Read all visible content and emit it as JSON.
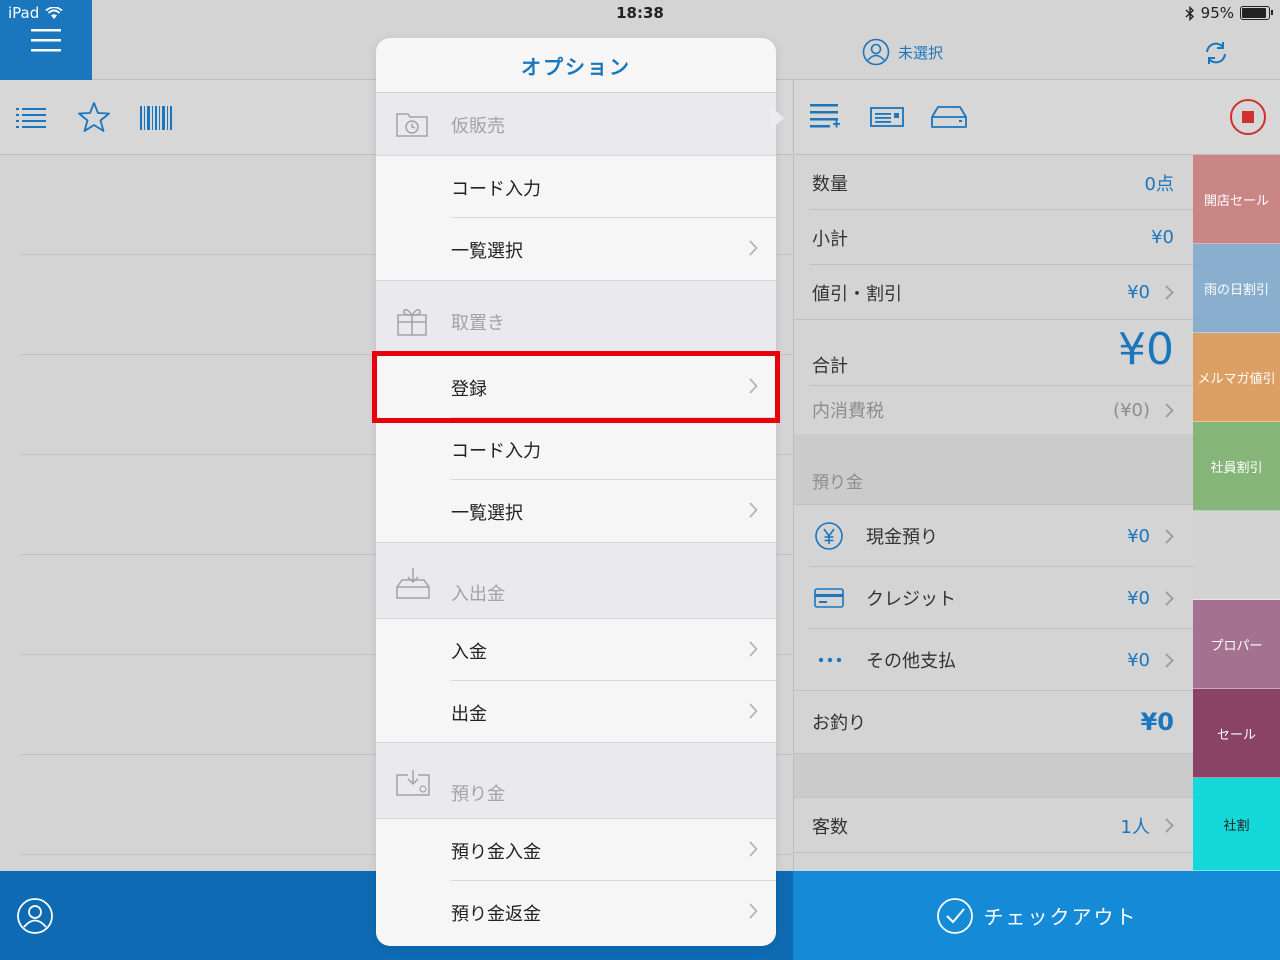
{
  "status_bar": {
    "device": "iPad",
    "time": "18:38",
    "battery": "95%",
    "battery_level": 0.95
  },
  "header": {
    "customer_label": "未選択"
  },
  "summary": {
    "quantity_label": "数量",
    "quantity_value": "0点",
    "subtotal_label": "小計",
    "subtotal_value": "¥0",
    "discount_label": "値引・割引",
    "discount_value": "¥0",
    "total_label": "合計",
    "total_value": "¥0",
    "tax_label": "内消費税",
    "tax_value": "(¥0)",
    "deposit_section": "預り金",
    "cash_label": "現金預り",
    "cash_value": "¥0",
    "credit_label": "クレジット",
    "credit_value": "¥0",
    "other_label": "その他支払",
    "other_value": "¥0",
    "change_label": "お釣り",
    "change_value": "¥0",
    "guests_label": "客数",
    "guests_value": "1人"
  },
  "discount_buttons": [
    {
      "label": "開店セール",
      "color": "#c98684"
    },
    {
      "label": "雨の日割引",
      "color": "#8aaecd"
    },
    {
      "label": "メルマガ値引",
      "color": "#dda064"
    },
    {
      "label": "社員割引",
      "color": "#86b57a"
    },
    {
      "label": "",
      "color": "#d3d3d3"
    },
    {
      "label": "プロパー",
      "color": "#a57190"
    },
    {
      "label": "セール",
      "color": "#8a4366"
    },
    {
      "label": "社割",
      "color": "#14d8da"
    }
  ],
  "checkout": {
    "label": "チェックアウト"
  },
  "popover": {
    "title": "オプション",
    "sections": [
      {
        "title": "仮販売",
        "icon": "clock-folder-icon",
        "items": [
          "コード入力",
          "一覧選択"
        ]
      },
      {
        "title": "取置き",
        "icon": "gift-icon",
        "items": [
          "登録",
          "コード入力",
          "一覧選択"
        ]
      },
      {
        "title": "入出金",
        "icon": "drawer-in-icon",
        "items": [
          "入金",
          "出金"
        ]
      },
      {
        "title": "預り金",
        "icon": "deposit-icon",
        "items": [
          "預り金入金",
          "預り金返金"
        ]
      }
    ]
  },
  "colors": {
    "accent": "#1a76bd",
    "highlight": "#e8000b",
    "stop": "#d03030"
  }
}
